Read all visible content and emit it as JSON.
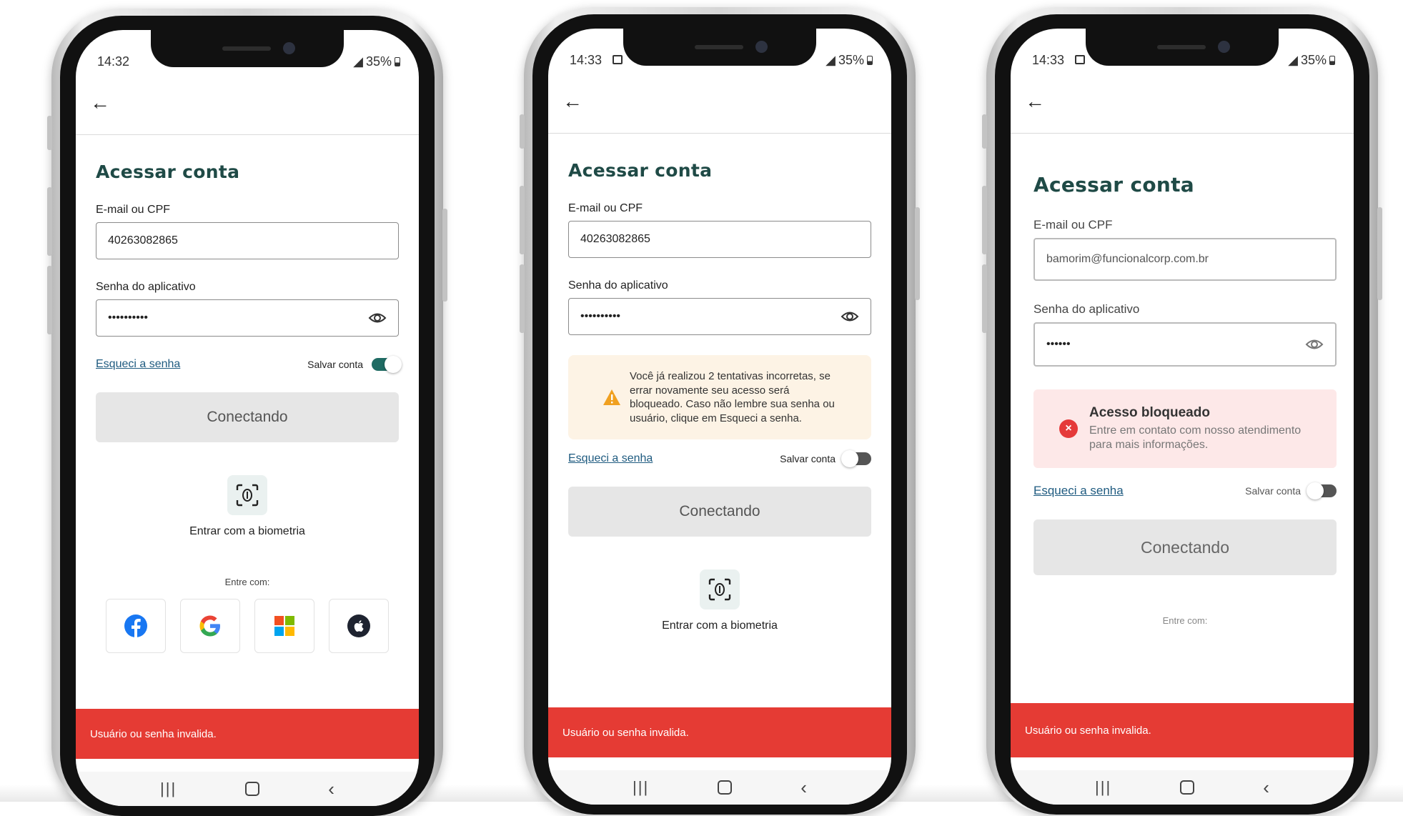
{
  "brand_colors": {
    "title": "#1f4a46",
    "toggle_on": "#1f6b63",
    "link": "#1f5b80",
    "snackbar": "#e53b34",
    "warning_bg": "#fdf3e5",
    "warning_icon": "#f0a020",
    "error_bg": "#fde8e8",
    "error_icon": "#e53a3a"
  },
  "phones": [
    {
      "status_time": "14:32",
      "battery": "35%",
      "title": "Acessar conta",
      "email_label": "E-mail ou CPF",
      "email_value": "40263082865",
      "password_label": "Senha do aplicativo",
      "password_value": "••••••••••",
      "forgot_link": "Esqueci a senha",
      "save_label": "Salvar conta",
      "save_toggle": "on",
      "connect_button": "Conectando",
      "biometrics_label": "Entrar com a biometria",
      "enter_with": "Entre com:",
      "social_icons": [
        "facebook-icon",
        "google-icon",
        "microsoft-icon",
        "apple-icon"
      ],
      "snackbar": "Usuário ou senha invalida."
    },
    {
      "status_time": "14:33",
      "battery": "35%",
      "title": "Acessar conta",
      "email_label": "E-mail ou CPF",
      "email_value": "40263082865",
      "password_label": "Senha do aplicativo",
      "password_value": "••••••••••",
      "warning_text": "Você já realizou 2 tentativas incorretas, se errar novamente seu acesso será bloqueado. Caso não lembre sua senha ou usuário, clique em Esqueci a senha.",
      "forgot_link": "Esqueci a senha",
      "save_label": "Salvar conta",
      "save_toggle": "off",
      "connect_button": "Conectando",
      "biometrics_label": "Entrar com a biometria",
      "snackbar": "Usuário ou senha invalida."
    },
    {
      "status_time": "14:33",
      "battery": "35%",
      "title": "Acessar conta",
      "email_label": "E-mail ou CPF",
      "email_value": "bamorim@funcionalcorp.com.br",
      "password_label": "Senha do aplicativo",
      "password_value": "••••••",
      "error_title": "Acesso bloqueado",
      "error_text": "Entre em contato com nosso atendimento para mais informações.",
      "forgot_link": "Esqueci a senha",
      "save_label": "Salvar conta",
      "save_toggle": "off",
      "connect_button": "Conectando",
      "enter_with": "Entre com:",
      "snackbar": "Usuário ou senha invalida."
    }
  ]
}
